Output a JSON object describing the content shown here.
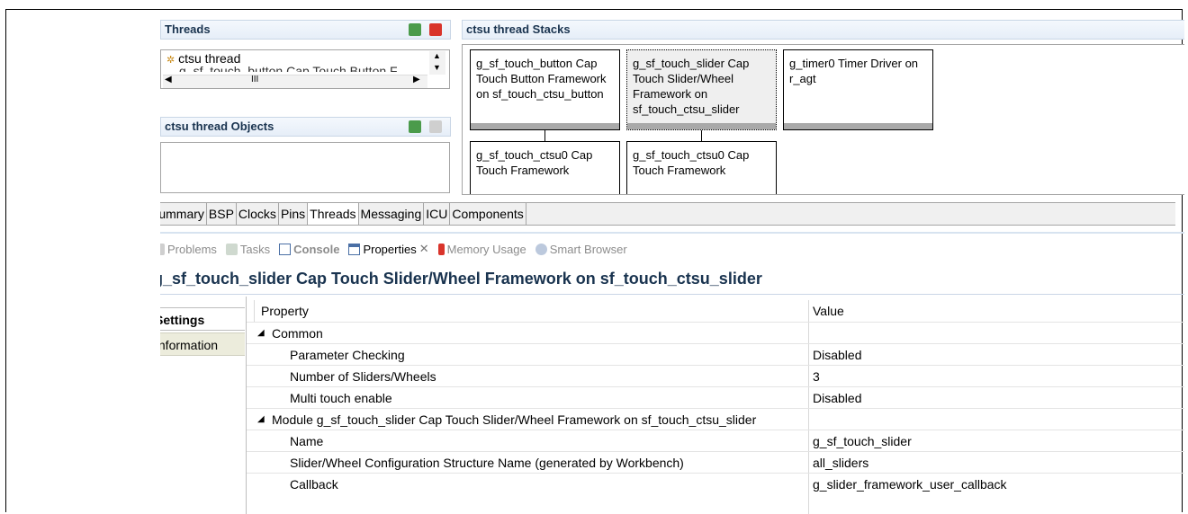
{
  "threads_panel": {
    "title": "Threads",
    "items": [
      "ctsu thread",
      "g_sf_touch_button Cap Touch Button F"
    ],
    "scroll_thumb": "III"
  },
  "objects_panel": {
    "title": "ctsu thread Objects"
  },
  "stacks_panel": {
    "title": "ctsu thread Stacks",
    "modules": [
      "g_sf_touch_button Cap Touch Button Framework on sf_touch_ctsu_button",
      "g_sf_touch_slider Cap Touch Slider/Wheel Framework on sf_touch_ctsu_slider",
      "g_timer0 Timer Driver on r_agt",
      "g_sf_touch_ctsu0 Cap Touch Framework",
      "g_sf_touch_ctsu0 Cap Touch Framework"
    ]
  },
  "config_tabs": [
    "Summary",
    "BSP",
    "Clocks",
    "Pins",
    "Threads",
    "Messaging",
    "ICU",
    "Components"
  ],
  "view_tabs": [
    "Problems",
    "Tasks",
    "Console",
    "Properties",
    "Memory Usage",
    "Smart Browser"
  ],
  "properties": {
    "title": "g_sf_touch_slider Cap Touch Slider/Wheel Framework on sf_touch_ctsu_slider",
    "nav": [
      "Settings",
      "Information"
    ],
    "col_property": "Property",
    "col_value": "Value",
    "rows": [
      {
        "p": "Common",
        "v": ""
      },
      {
        "p": "Parameter Checking",
        "v": "Disabled"
      },
      {
        "p": "Number of Sliders/Wheels",
        "v": "3"
      },
      {
        "p": "Multi touch enable",
        "v": "Disabled"
      },
      {
        "p": "Module g_sf_touch_slider Cap Touch Slider/Wheel Framework on sf_touch_ctsu_slider",
        "v": ""
      },
      {
        "p": "Name",
        "v": "g_sf_touch_slider"
      },
      {
        "p": "Slider/Wheel Configuration Structure Name (generated by Workbench)",
        "v": "all_sliders"
      },
      {
        "p": "Callback",
        "v": "g_slider_framework_user_callback"
      }
    ]
  },
  "colors": {
    "header_text": "#19334f",
    "accent_green": "#3a9a3a",
    "accent_red": "#d9342b"
  }
}
